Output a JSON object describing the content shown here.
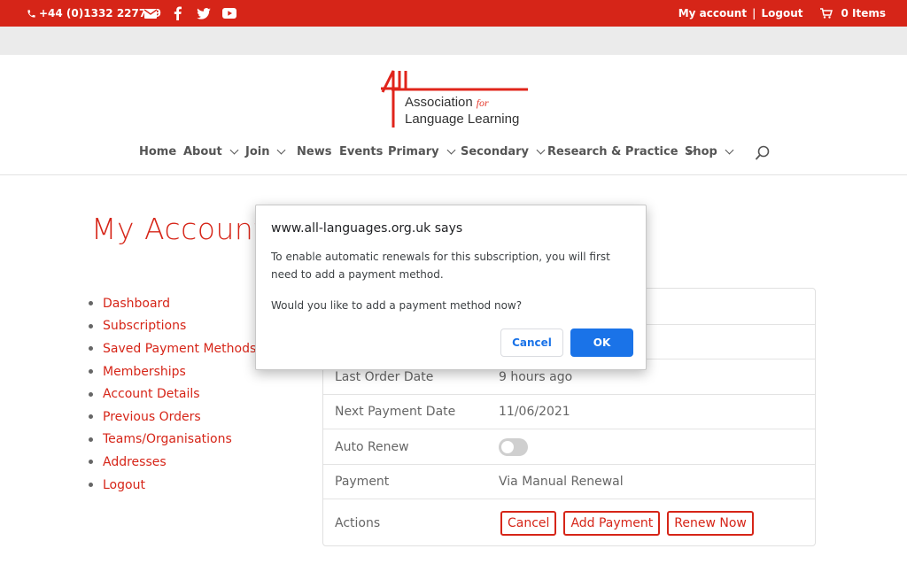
{
  "topbar": {
    "phone": "+44 (0)1332 227779",
    "icons": [
      "phone-icon",
      "email-icon",
      "facebook-icon",
      "twitter-icon",
      "youtube-icon",
      "cart-icon"
    ],
    "my_account": "My account",
    "separator": "|",
    "logout": "Logout",
    "cart": "0 Items"
  },
  "logo": {
    "line1": "Association",
    "for": "for",
    "line2": "Language Learning"
  },
  "nav": {
    "items": [
      {
        "label": "Home"
      },
      {
        "label": "About"
      },
      {
        "label": "Join"
      },
      {
        "label": "News"
      },
      {
        "label": "Events"
      },
      {
        "label": "Primary"
      },
      {
        "label": "Secondary"
      },
      {
        "label": "Research & Practice"
      },
      {
        "label": "Shop"
      }
    ]
  },
  "page": {
    "title": "My Account"
  },
  "sidebar": {
    "items": [
      {
        "label": "Dashboard"
      },
      {
        "label": "Subscriptions"
      },
      {
        "label": "Saved Payment Methods"
      },
      {
        "label": "Memberships"
      },
      {
        "label": "Account Details"
      },
      {
        "label": "Previous Orders"
      },
      {
        "label": "Teams/Organisations"
      },
      {
        "label": "Addresses"
      },
      {
        "label": "Logout"
      }
    ]
  },
  "details": {
    "last_order_label": "Last Order Date",
    "last_order_value": "9 hours ago",
    "next_payment_label": "Next Payment Date",
    "next_payment_value": "11/06/2021",
    "auto_renew_label": "Auto Renew",
    "auto_renew_on": false,
    "payment_label": "Payment",
    "payment_value": "Via Manual Renewal",
    "actions_label": "Actions",
    "actions": {
      "cancel": "Cancel",
      "add_payment": "Add Payment",
      "renew_now": "Renew Now"
    }
  },
  "dialog": {
    "title": "www.all-languages.org.uk says",
    "message1": "To enable automatic renewals for this subscription, you will first need to add a payment method.",
    "message2": "Would you like to add a payment method now?",
    "cancel": "Cancel",
    "ok": "OK"
  },
  "colors": {
    "brand": "#d62518",
    "dialog_primary": "#1a73e8"
  }
}
